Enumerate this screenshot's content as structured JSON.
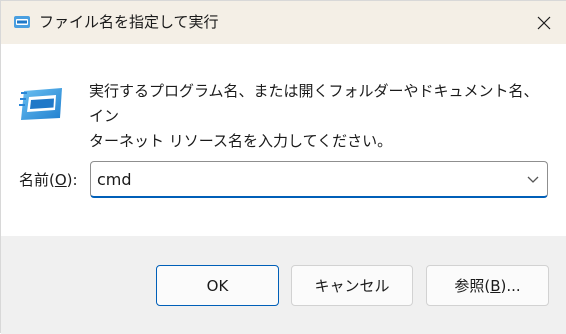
{
  "window": {
    "title": "ファイル名を指定して実行",
    "title_icon": "run-icon",
    "close_icon": "close-icon"
  },
  "content": {
    "app_icon": "run-dialog-icon",
    "description_line1": "実行するプログラム名、または開くフォルダーやドキュメント名、イン",
    "description_line2": "ターネット リソース名を入力してください。",
    "open_label_prefix": "名前(",
    "open_label_mnemonic": "O",
    "open_label_suffix": "):",
    "input_value": "cmd",
    "dropdown_icon": "chevron-down-icon"
  },
  "buttons": {
    "ok": "OK",
    "cancel": "キャンセル",
    "browse_prefix": "参照(",
    "browse_mnemonic": "B",
    "browse_suffix": ")..."
  },
  "colors": {
    "titlebar": "#f4efe6",
    "accent": "#005fb8",
    "footer": "#f0f0f0"
  }
}
